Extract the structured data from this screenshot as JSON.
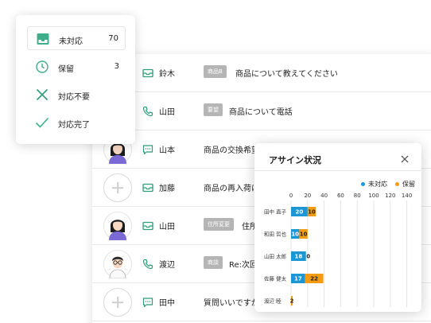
{
  "colors": {
    "unhandled": "#1a97d4",
    "hold": "#f39c12",
    "done_check": "#3fae8c",
    "icon_green": "#2e9e78",
    "x_green": "#2e9e78"
  },
  "status_card": {
    "items": [
      {
        "label": "未対応",
        "count": "70",
        "icon": "inbox-icon"
      },
      {
        "label": "保留",
        "count": "3",
        "icon": "clock-icon"
      },
      {
        "label": "対応不要",
        "count": "",
        "icon": "x-icon"
      },
      {
        "label": "対応完了",
        "count": "",
        "icon": "check-icon"
      }
    ]
  },
  "inbox": {
    "rows": [
      {
        "name": "鈴木",
        "channel": "mail-icon",
        "tag": "商品B",
        "subject": "商品について教えてください",
        "avatar": "none"
      },
      {
        "name": "山田",
        "channel": "phone-icon",
        "tag": "要望",
        "subject": "商品について電話",
        "avatar": "none"
      },
      {
        "name": "山本",
        "channel": "chat-icon",
        "tag": "",
        "subject": "商品の交換希望",
        "avatar": "person"
      },
      {
        "name": "加藤",
        "channel": "mail-icon",
        "tag": "",
        "subject": "商品の再入荷に",
        "avatar": "placeholder"
      },
      {
        "name": "山田",
        "channel": "mail-icon",
        "tag": "住所変更",
        "subject": "住所",
        "avatar": "person"
      },
      {
        "name": "渡辺",
        "channel": "phone-icon",
        "tag": "商談",
        "subject": "Re:次回",
        "avatar": "person-glasses"
      },
      {
        "name": "田中",
        "channel": "chat-icon",
        "tag": "",
        "subject": "質問いいですか",
        "avatar": "placeholder"
      }
    ]
  },
  "assign_modal": {
    "title": "アサイン状況",
    "legend": {
      "unhandled": "未対応",
      "hold": "保留"
    }
  },
  "chart_data": {
    "type": "bar",
    "orientation": "horizontal",
    "stacked": true,
    "categories": [
      "田中 直子",
      "和田 哲也",
      "山田 太郎",
      "佐藤 健太",
      "渡辺 睦"
    ],
    "series": [
      {
        "name": "未対応",
        "values": [
          20,
          10,
          18,
          17,
          0
        ]
      },
      {
        "name": "保留",
        "values": [
          10,
          10,
          0,
          22,
          2
        ]
      }
    ],
    "data_labels": [
      [
        "20",
        "10"
      ],
      [
        "10",
        "10"
      ],
      [
        "18",
        "0"
      ],
      [
        "17",
        "22"
      ],
      [
        "",
        "2"
      ]
    ],
    "xlim": [
      0,
      140
    ],
    "xticks": [
      "0",
      "20",
      "40",
      "60",
      "80",
      "100",
      "120",
      "140"
    ],
    "grid": true,
    "legend_position": "top-right"
  }
}
